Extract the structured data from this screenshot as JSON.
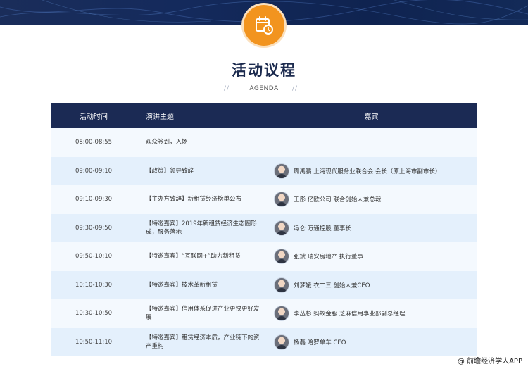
{
  "header": {
    "title": "活动议程",
    "subtitle": "AGENDA",
    "deco_left": "//",
    "deco_right": "//"
  },
  "colors": {
    "navy": "#1b2a54",
    "accent_orange": "#f2941f",
    "row_light": "#f4f9fe",
    "row_blue": "#e4f0fc"
  },
  "icons": {
    "badge": "calendar-clock-icon"
  },
  "table": {
    "columns": [
      "活动时间",
      "演讲主题",
      "嘉宾"
    ],
    "rows": [
      {
        "time": "08:00-08:55",
        "topic": "观众签到，入场",
        "guest": ""
      },
      {
        "time": "09:00-09:10",
        "topic": "【政策】领导致辞",
        "guest": "周禹鹏 上海现代服务业联合会 会长（原上海市副市长）"
      },
      {
        "time": "09:10-09:30",
        "topic": "【主办方致辞】新租赁经济榜单公布",
        "guest": "王彤 亿欧公司 联合创始人兼总裁"
      },
      {
        "time": "09:30-09:50",
        "topic": "【特邀嘉宾】2019年新租赁经济生态圈形成，服务落地",
        "guest": "冯仑 万通控股 董事长"
      },
      {
        "time": "09:50-10:10",
        "topic": "【特邀嘉宾】“互联网+”助力新租赁",
        "guest": "张斌 瑞安房地产 执行董事"
      },
      {
        "time": "10:10-10:30",
        "topic": "【特邀嘉宾】技术革新租赁",
        "guest": "刘梦媛 衣二三 创始人兼CEO"
      },
      {
        "time": "10:30-10:50",
        "topic": "【特邀嘉宾】信用体系促进产业更快更好发展",
        "guest": "李丛杉 蚂蚁金服 芝麻信用事业部副总经理"
      },
      {
        "time": "10:50-11:10",
        "topic": "【特邀嘉宾】租赁经济本质，产业链下的资产重构",
        "guest": "杨磊 哈罗单车 CEO"
      }
    ]
  },
  "watermark": "@ 前瞻经济学人APP"
}
